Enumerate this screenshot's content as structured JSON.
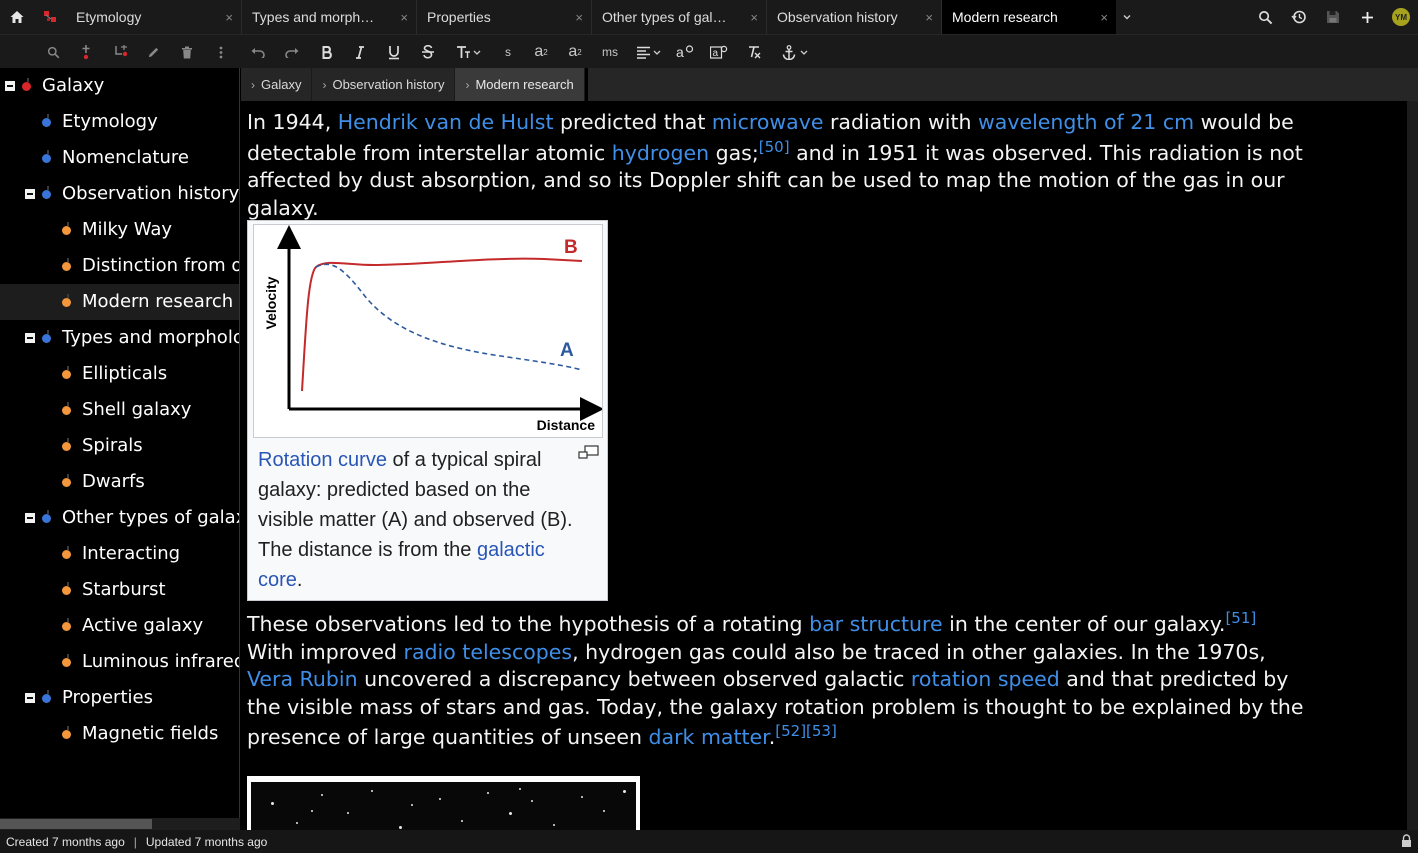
{
  "tabs": [
    {
      "title": "Etymology",
      "close": "×"
    },
    {
      "title": "Types and morph…",
      "close": "×"
    },
    {
      "title": "Properties",
      "close": "×"
    },
    {
      "title": "Other types of gal…",
      "close": "×"
    },
    {
      "title": "Observation history",
      "close": "×"
    },
    {
      "title": "Modern research",
      "close": "×"
    }
  ],
  "user_initials": "YM",
  "toolbar": {
    "superscript": "a",
    "subscript": "a",
    "strikethrough_label": "s",
    "monospace_label": "ms"
  },
  "tree": [
    {
      "label": "Galaxy",
      "color": "#d9262a"
    },
    {
      "label": "Etymology",
      "color": "#3975d8"
    },
    {
      "label": "Nomenclature",
      "color": "#3975d8"
    },
    {
      "label": "Observation history",
      "color": "#3975d8"
    },
    {
      "label": "Milky Way",
      "color": "#f2973c"
    },
    {
      "label": "Distinction from other nebulae",
      "color": "#f2973c"
    },
    {
      "label": "Modern research",
      "color": "#f2973c"
    },
    {
      "label": "Types and morphology",
      "color": "#3975d8"
    },
    {
      "label": "Ellipticals",
      "color": "#f2973c"
    },
    {
      "label": "Shell galaxy",
      "color": "#f2973c"
    },
    {
      "label": "Spirals",
      "color": "#f2973c"
    },
    {
      "label": "Dwarfs",
      "color": "#f2973c"
    },
    {
      "label": "Other types of galaxies",
      "color": "#3975d8"
    },
    {
      "label": "Interacting",
      "color": "#f2973c"
    },
    {
      "label": "Starburst",
      "color": "#f2973c"
    },
    {
      "label": "Active galaxy",
      "color": "#f2973c"
    },
    {
      "label": "Luminous infrared galaxy",
      "color": "#f2973c"
    },
    {
      "label": "Properties",
      "color": "#3975d8"
    },
    {
      "label": "Magnetic fields",
      "color": "#f2973c"
    }
  ],
  "breadcrumbs": [
    "Galaxy",
    "Observation history",
    "Modern research"
  ],
  "p1": {
    "l1a": "In 1944, ",
    "l1b": "Hendrik van de Hulst",
    "l1c": " predicted that ",
    "l1d": "microwave",
    "l1e": " radiation with ",
    "l1f": "wavelength of 21 cm",
    "l1g": " would be",
    "l2a": "detectable from interstellar atomic ",
    "l2b": "hydrogen",
    "l2c": " gas;",
    "l2d": "[50]",
    "l2e": " and in 1951 it was observed. This radiation is not",
    "l3": "affected by dust absorption, and so its Doppler shift can be used to map the motion of the gas in our",
    "l4": "galaxy."
  },
  "figure": {
    "ylabel": "Velocity",
    "xlabel": "Distance",
    "labelB": "B",
    "labelA": "A",
    "cap_link1": "Rotation curve",
    "cap_t1": " of a typical spiral",
    "cap_t2": "galaxy: predicted based on the",
    "cap_t3": "visible matter (A) and observed (B).",
    "cap_t4": "The distance is from the ",
    "cap_link2": "galactic",
    "cap_link3": "core",
    "cap_t5": "."
  },
  "p2": {
    "l1a": "These observations led to the hypothesis of a rotating ",
    "l1b": "bar structure",
    "l1c": " in the center of our galaxy.",
    "l1d": "[51]",
    "l2a": "With improved ",
    "l2b": "radio telescopes",
    "l2c": ", hydrogen gas could also be traced in other galaxies. In the 1970s,",
    "l3a": "Vera Rubin",
    "l3b": " uncovered a discrepancy between observed galactic ",
    "l3c": "rotation speed",
    "l3d": " and that predicted by",
    "l4": "the visible mass of stars and gas. Today, the galaxy rotation problem is thought to be explained by the",
    "l5a": "presence of large quantities of unseen ",
    "l5b": "dark matter",
    "l5c": ".",
    "l5d": "[52][53]"
  },
  "status": {
    "created": "Created 7 months ago",
    "sep": "|",
    "updated": "Updated 7 months ago"
  }
}
